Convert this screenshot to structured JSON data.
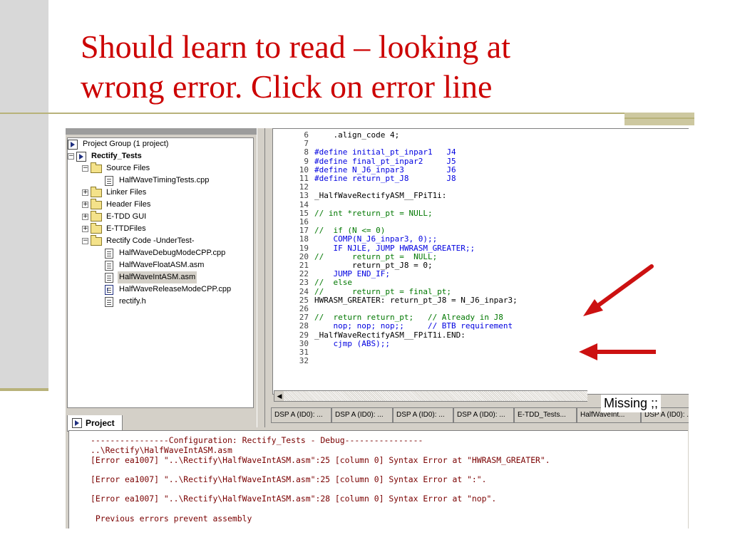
{
  "slide": {
    "title_line1": "Should learn to read – looking at",
    "title_line2": "wrong error. Click on error line",
    "colors": {
      "title": "#cc0000",
      "rule": "#b8b27a",
      "arrow": "#cc1111"
    }
  },
  "project_panel": {
    "tree": {
      "group": "Project Group (1 project)",
      "project": "Rectify_Tests",
      "source_files": "Source Files",
      "source_file_1": "HalfWaveTimingTests.cpp",
      "linker_files": "Linker Files",
      "header_files": "Header Files",
      "etdd_gui": "E-TDD GUI",
      "ettd_files": "E-TTDFiles",
      "rectify_code": "Rectify Code -UnderTest-",
      "rc_file_1": "HalfWaveDebugModeCPP.cpp",
      "rc_file_2": "HalfWaveFloatASM.asm",
      "rc_file_3": "HalfWaveIntASM.asm",
      "rc_file_4": "HalfWaveReleaseModeCPP.cpp",
      "rc_file_5": "rectify.h"
    },
    "tab_label": "Project"
  },
  "editor": {
    "lines": [
      {
        "num": "6",
        "text": "    .align_code 4;"
      },
      {
        "num": "7",
        "text": ""
      },
      {
        "num": "8",
        "text": "#define initial_pt_inpar1   J4"
      },
      {
        "num": "9",
        "text": "#define final_pt_inpar2     J5"
      },
      {
        "num": "10",
        "text": "#define N_J6_inpar3         J6"
      },
      {
        "num": "11",
        "text": "#define return_pt_J8        J8"
      },
      {
        "num": "12",
        "text": ""
      },
      {
        "num": "13",
        "text": "_HalfWaveRectifyASM__FPiT1i:"
      },
      {
        "num": "14",
        "text": ""
      },
      {
        "num": "15",
        "text": "// int *return_pt = NULL;"
      },
      {
        "num": "16",
        "text": ""
      },
      {
        "num": "17",
        "text": "//  if (N <= 0)"
      },
      {
        "num": "18",
        "text": "    COMP(N_J6_inpar3, 0);;"
      },
      {
        "num": "19",
        "text": "    IF NJLE, JUMP HWRASM_GREATER;;"
      },
      {
        "num": "20",
        "text": "//      return_pt =  NULL;"
      },
      {
        "num": "21",
        "text": "        return_pt_J8 = 0;"
      },
      {
        "num": "22",
        "text": "    JUMP END_IF;"
      },
      {
        "num": "23",
        "text": "//  else"
      },
      {
        "num": "24",
        "text": "//      return_pt = final_pt;"
      },
      {
        "num": "25",
        "text": "HWRASM_GREATER: return_pt_J8 = N_J6_inpar3;"
      },
      {
        "num": "26",
        "text": ""
      },
      {
        "num": "27",
        "text": "//  return return_pt;   // Already in J8"
      },
      {
        "num": "28",
        "text": "    nop; nop; nop;;     // BTB requirement"
      },
      {
        "num": "29",
        "text": "_HalfWaveRectifyASM__FPiT1i.END:"
      },
      {
        "num": "30",
        "text": "    cjmp (ABS);;"
      },
      {
        "num": "31",
        "text": ""
      },
      {
        "num": "32",
        "text": ""
      }
    ]
  },
  "doc_tabs": [
    "DSP A (ID0): ...",
    "DSP A (ID0): ...",
    "DSP A (ID0): ...",
    "DSP A (ID0): ...",
    "E-TDD_Tests...",
    "HalfWaveInt...",
    "DSP A (ID0): ..."
  ],
  "output": {
    "line1": "----------------Configuration: Rectify_Tests - Debug----------------",
    "line2": "..\\Rectify\\HalfWaveIntASM.asm",
    "line3": "[Error ea1007] \"..\\Rectify\\HalfWaveIntASM.asm\":25 [column 0] Syntax Error at \"HWRASM_GREATER\".",
    "line4": "[Error ea1007] \"..\\Rectify\\HalfWaveIntASM.asm\":25 [column 0] Syntax Error at \":\".",
    "line5": "[Error ea1007] \"..\\Rectify\\HalfWaveIntASM.asm\":28 [column 0] Syntax Error at \"nop\".",
    "line6": " Previous errors prevent assembly"
  },
  "annotation": {
    "missing_label": "Missing ;;"
  }
}
